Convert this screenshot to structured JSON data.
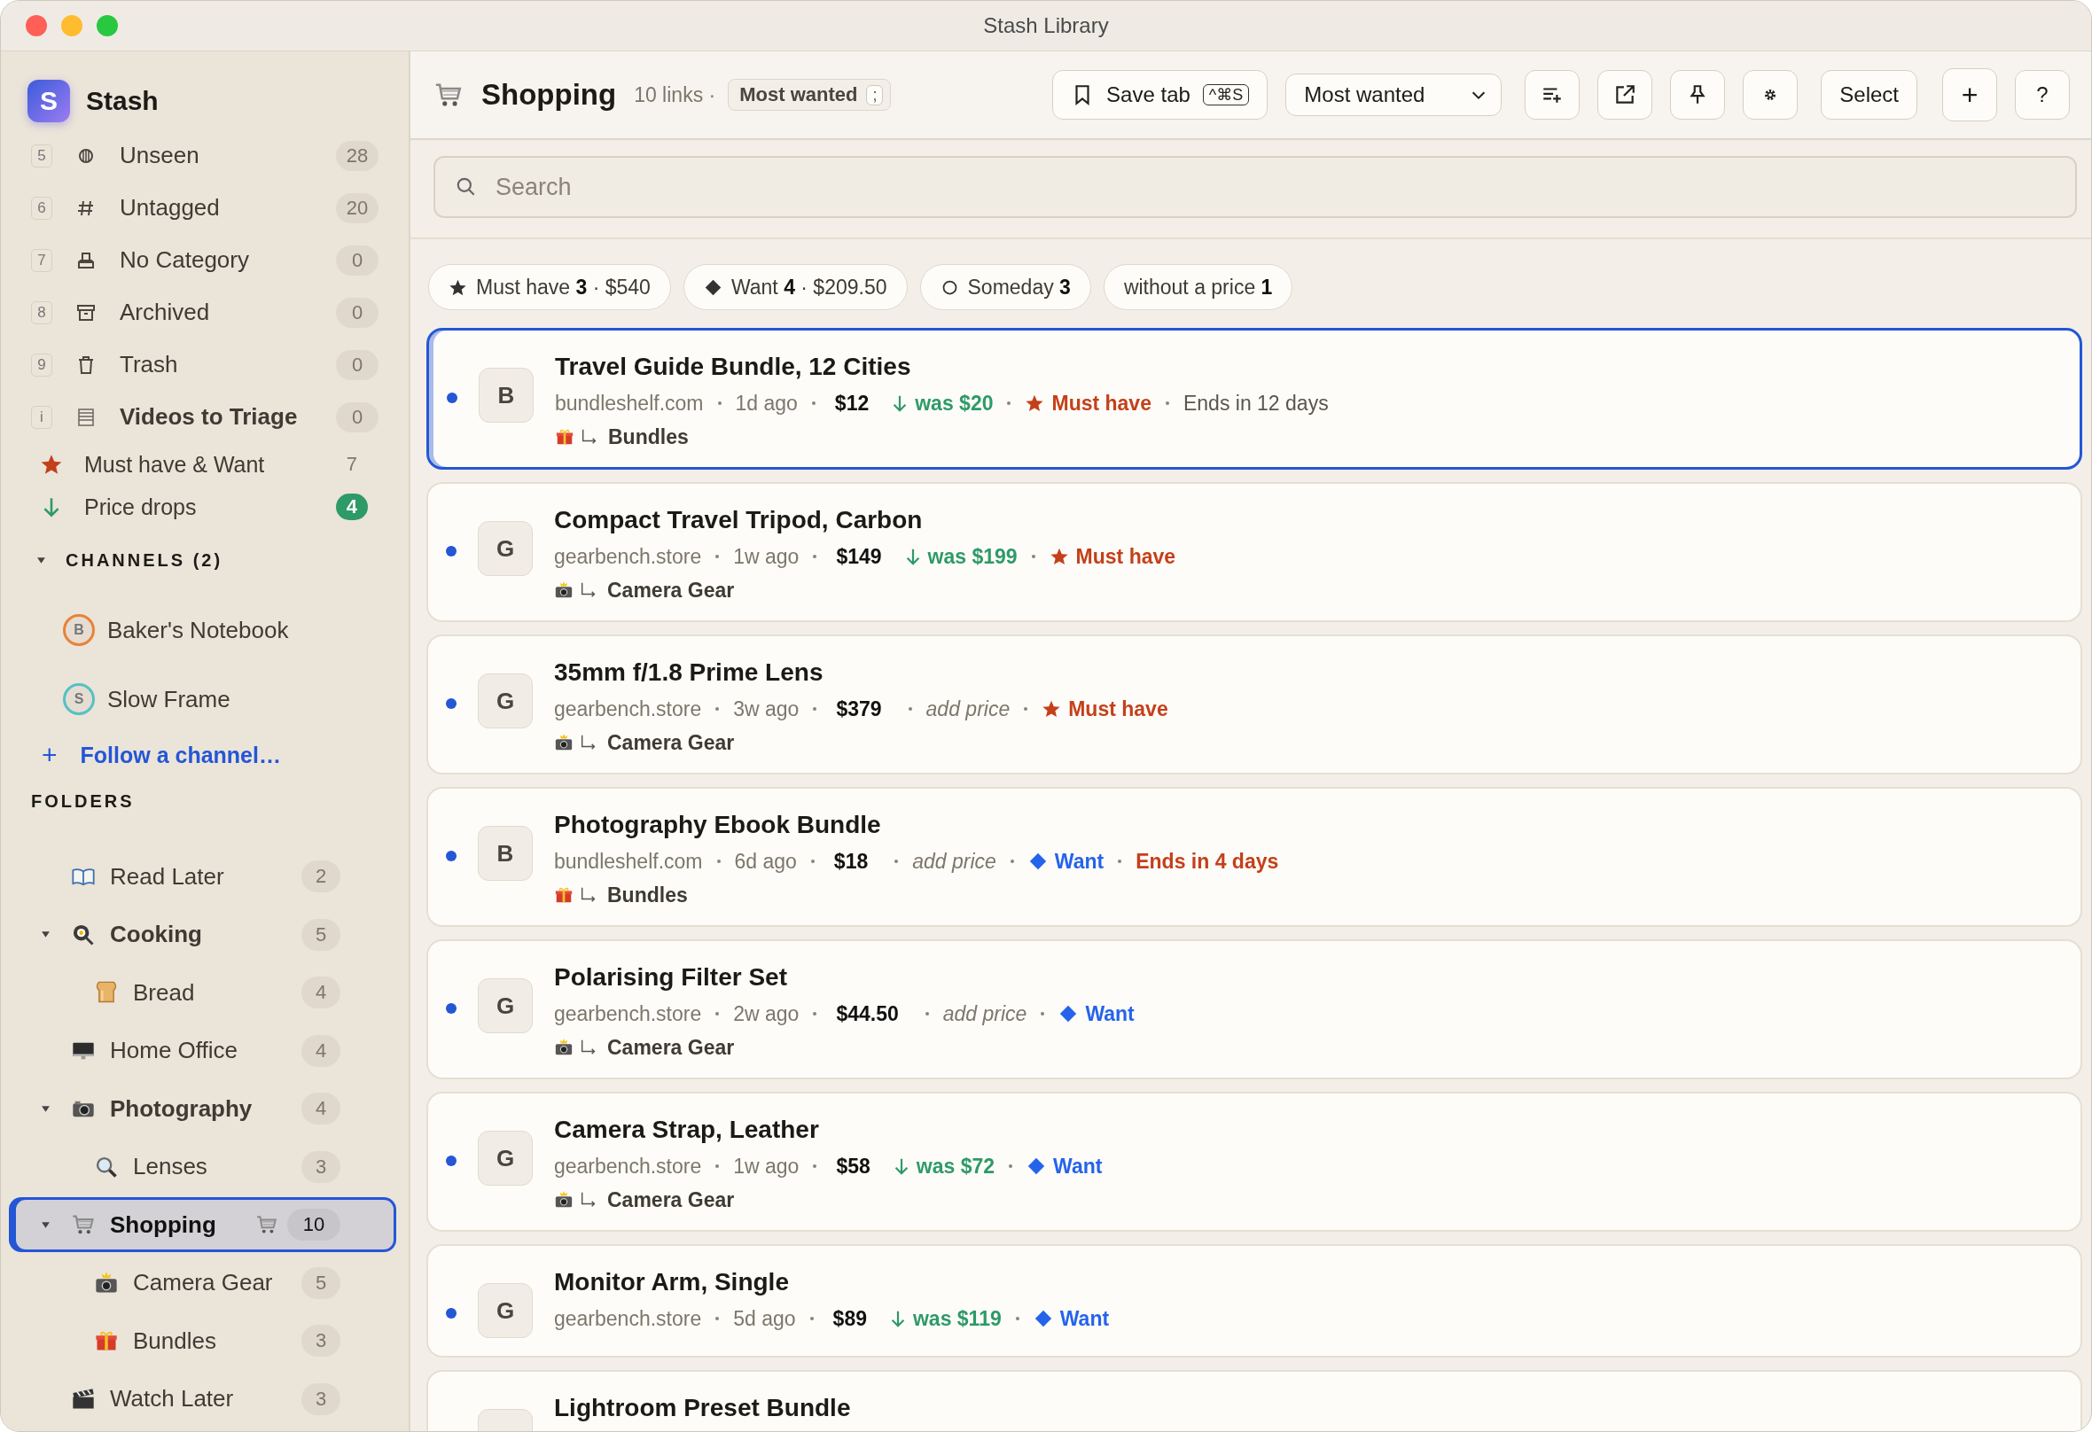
{
  "window": {
    "title": "Stash Library"
  },
  "sidebar": {
    "app_name": "Stash",
    "logo_letter": "S",
    "views": [
      {
        "key": "5",
        "label": "Unseen",
        "count": "28",
        "bold": false
      },
      {
        "key": "6",
        "label": "Untagged",
        "count": "20",
        "bold": false
      },
      {
        "key": "7",
        "label": "No Category",
        "count": "0",
        "bold": false
      },
      {
        "key": "8",
        "label": "Archived",
        "count": "0",
        "bold": false
      },
      {
        "key": "9",
        "label": "Trash",
        "count": "0",
        "bold": false
      },
      {
        "key": "i",
        "label": "Videos to Triage",
        "count": "0",
        "bold": true
      }
    ],
    "smart": [
      {
        "kind": "star",
        "label": "Must have & Want",
        "count": "7",
        "highlight": false
      },
      {
        "kind": "drop",
        "label": "Price drops",
        "count": "4",
        "highlight": true
      }
    ],
    "channels": {
      "title": "CHANNELS (2)",
      "expanded": true,
      "items": [
        {
          "initial": "B",
          "name": "Baker's Notebook",
          "color": "#e8823a"
        },
        {
          "initial": "S",
          "name": "Slow Frame",
          "color": "#55c1c4"
        }
      ],
      "follow": {
        "icon": "+",
        "label": "Follow a channel…"
      }
    },
    "folders_title": "FOLDERS",
    "folders": [
      {
        "label": "Read Later",
        "count": "2",
        "selected": false
      },
      {
        "label": "Cooking",
        "count": "5",
        "selected": false,
        "expanded": true,
        "children": [
          {
            "label": "Bread",
            "count": "4",
            "selected": false
          }
        ]
      },
      {
        "label": "Home Office",
        "count": "4",
        "selected": false
      },
      {
        "label": "Photography",
        "count": "4",
        "selected": false,
        "expanded": true,
        "children": [
          {
            "label": "Lenses",
            "count": "3",
            "selected": false
          }
        ]
      },
      {
        "label": "Shopping",
        "count": "10",
        "selected": true,
        "saved_tab": true,
        "expanded": true,
        "children": [
          {
            "label": "Camera Gear",
            "count": "5",
            "selected": false
          },
          {
            "label": "Bundles",
            "count": "3",
            "selected": false
          }
        ]
      },
      {
        "label": "Watch Later",
        "count": "3",
        "selected": false
      }
    ]
  },
  "header": {
    "title": "Shopping",
    "subtitle": "10 links ·",
    "sort_chip": {
      "label": "Most wanted",
      "key": ";"
    },
    "save_tab": {
      "label": "Save tab",
      "shortcut": "^⌘S"
    },
    "sort_select": {
      "value": "Most wanted"
    },
    "select_button": "Select",
    "add_button": "+",
    "help_button": "?"
  },
  "search": {
    "placeholder": "Search"
  },
  "filters": [
    {
      "kind": "must",
      "label": "Must have",
      "count": "3",
      "total": "· $540"
    },
    {
      "kind": "want",
      "label": "Want",
      "count": "4",
      "total": "· $209.50"
    },
    {
      "kind": "someday",
      "label": "Someday",
      "count": "3"
    },
    {
      "kind": "unpriced",
      "label": "without a price",
      "count": "1"
    }
  ],
  "cards": [
    {
      "selected": true,
      "unread": true,
      "avatar": "B",
      "title": "Travel Guide Bundle, 12 Cities",
      "source": "bundleshelf.com",
      "age": "1d ago",
      "price": "$12",
      "price_note": {
        "kind": "drop",
        "text": "was $20"
      },
      "priority": {
        "kind": "must",
        "label": "Must have"
      },
      "ends": {
        "text": "Ends in 12 days",
        "urgent": false
      },
      "folder": "Bundles"
    },
    {
      "selected": false,
      "unread": true,
      "avatar": "G",
      "title": "Compact Travel Tripod, Carbon",
      "source": "gearbench.store",
      "age": "1w ago",
      "price": "$149",
      "price_note": {
        "kind": "drop",
        "text": "was $199"
      },
      "priority": {
        "kind": "must",
        "label": "Must have"
      },
      "folder": "Camera Gear"
    },
    {
      "selected": false,
      "unread": true,
      "avatar": "G",
      "title": "35mm f/1.8 Prime Lens",
      "source": "gearbench.store",
      "age": "3w ago",
      "price": "$379",
      "price_note": {
        "kind": "missing",
        "text": "add price"
      },
      "priority": {
        "kind": "must",
        "label": "Must have"
      },
      "folder": "Camera Gear"
    },
    {
      "selected": false,
      "unread": true,
      "avatar": "B",
      "title": "Photography Ebook Bundle",
      "source": "bundleshelf.com",
      "age": "6d ago",
      "price": "$18",
      "price_note": {
        "kind": "missing",
        "text": "add price"
      },
      "priority": {
        "kind": "want",
        "label": "Want"
      },
      "ends": {
        "text": "Ends in 4 days",
        "urgent": true
      },
      "folder": "Bundles"
    },
    {
      "selected": false,
      "unread": true,
      "avatar": "G",
      "title": "Polarising Filter Set",
      "source": "gearbench.store",
      "age": "2w ago",
      "price": "$44.50",
      "price_note": {
        "kind": "missing",
        "text": "add price"
      },
      "priority": {
        "kind": "want",
        "label": "Want"
      },
      "folder": "Camera Gear"
    },
    {
      "selected": false,
      "unread": true,
      "avatar": "G",
      "title": "Camera Strap, Leather",
      "source": "gearbench.store",
      "age": "1w ago",
      "price": "$58",
      "price_note": {
        "kind": "drop",
        "text": "was $72"
      },
      "priority": {
        "kind": "want",
        "label": "Want"
      },
      "folder": "Camera Gear"
    },
    {
      "selected": false,
      "unread": true,
      "avatar": "G",
      "title": "Monitor Arm, Single",
      "source": "gearbench.store",
      "age": "5d ago",
      "price": "$89",
      "price_note": {
        "kind": "drop",
        "text": "was $119"
      },
      "priority": {
        "kind": "want",
        "label": "Want"
      }
    },
    {
      "selected": false,
      "title": "Lightroom Preset Bundle"
    }
  ]
}
